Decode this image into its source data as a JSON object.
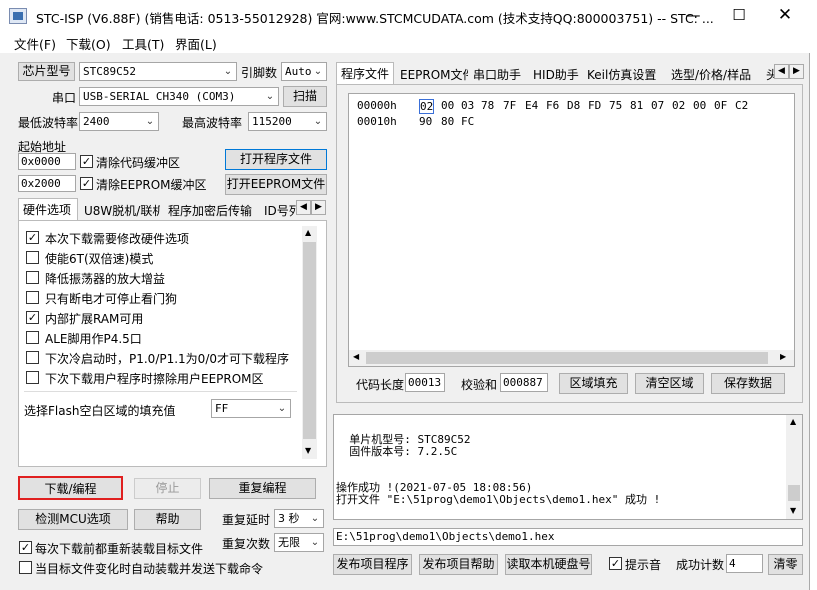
{
  "window": {
    "title": "STC-ISP (V6.88F) (销售电话: 0513-55012928) 官网:www.STCMCUDATA.com  (技术支持QQ:800003751) -- STC: ..."
  },
  "menu": [
    "文件(F)",
    "下载(O)",
    "工具(T)",
    "界面(L)"
  ],
  "left": {
    "chip_label": "芯片型号",
    "chip_value": "STC89C52",
    "pins_label": "引脚数",
    "pins_value": "Auto",
    "port_label": "串口",
    "port_value": "USB-SERIAL CH340 (COM3)",
    "scan_button": "扫描",
    "min_baud_label": "最低波特率",
    "min_baud_value": "2400",
    "max_baud_label": "最高波特率",
    "max_baud_value": "115200",
    "start_addr_label": "起始地址",
    "code_addr": "0x0000",
    "clear_code_label": "清除代码缓冲区",
    "open_program_button": "打开程序文件",
    "eeprom_addr": "0x2000",
    "clear_eeprom_label": "清除EEPROM缓冲区",
    "open_eeprom_button": "打开EEPROM文件",
    "tabs": [
      "硬件选项",
      "U8W脱机/联机",
      "程序加密后传输",
      "ID号列"
    ],
    "options": [
      {
        "label": "本次下载需要修改硬件选项",
        "checked": true
      },
      {
        "label": "使能6T(双倍速)模式",
        "checked": false
      },
      {
        "label": "降低振荡器的放大增益",
        "checked": false
      },
      {
        "label": "只有断电才可停止看门狗",
        "checked": false
      },
      {
        "label": "内部扩展RAM可用",
        "checked": true
      },
      {
        "label": "ALE脚用作P4.5口",
        "checked": false
      },
      {
        "label": "下次冷启动时，P1.0/P1.1为0/0才可下载程序",
        "checked": false
      },
      {
        "label": "下次下载用户程序时擦除用户EEPROM区",
        "checked": false
      }
    ],
    "fill_label": "选择Flash空白区域的填充值",
    "fill_value": "FF",
    "download_button": "下载/编程",
    "stop_button": "停止",
    "reprogram_button": "重复编程",
    "detect_button": "检测MCU选项",
    "help_button": "帮助",
    "delay_label": "重复延时",
    "delay_value": "3 秒",
    "repeat_label": "重复次数",
    "repeat_value": "无限",
    "reload_label": "每次下载前都重新装载目标文件",
    "reload_checked": true,
    "auto_label": "当目标文件变化时自动装载并发送下载命令",
    "auto_checked": false
  },
  "right": {
    "tabs": [
      "程序文件",
      "EEPROM文件",
      "串口助手",
      "HID助手",
      "Keil仿真设置",
      "选型/价格/样品",
      "头"
    ],
    "hex_rows": [
      {
        "addr": "00000h",
        "bytes": [
          "02",
          "00",
          "03",
          "78",
          "7F",
          "E4",
          "F6",
          "D8",
          "FD",
          "75",
          "81",
          "07",
          "02",
          "00",
          "0F",
          "C2"
        ]
      },
      {
        "addr": "00010h",
        "bytes": [
          "90",
          "80",
          "FC"
        ]
      }
    ],
    "code_len_label": "代码长度",
    "code_len_value": "00013",
    "checksum_label": "校验和",
    "checksum_value": "000887",
    "fill_region_button": "区域填充",
    "clear_region_button": "清空区域",
    "save_button": "保存数据",
    "log_lines": [
      "  单片机型号: STC89C52",
      "  固件版本号: 7.2.5C",
      "",
      "",
      "操作成功 !(2021-07-05 18:08:56)",
      "打开文件 \"E:\\51prog\\demo1\\Objects\\demo1.hex\" 成功 !"
    ],
    "path_value": "E:\\51prog\\demo1\\Objects\\demo1.hex",
    "publish_button": "发布项目程序",
    "publish_help_button": "发布项目帮助",
    "read_disk_button": "读取本机硬盘号",
    "beep_label": "提示音",
    "beep_checked": true,
    "success_count_label": "成功计数",
    "success_count_value": "4",
    "clear_button": "清零"
  }
}
